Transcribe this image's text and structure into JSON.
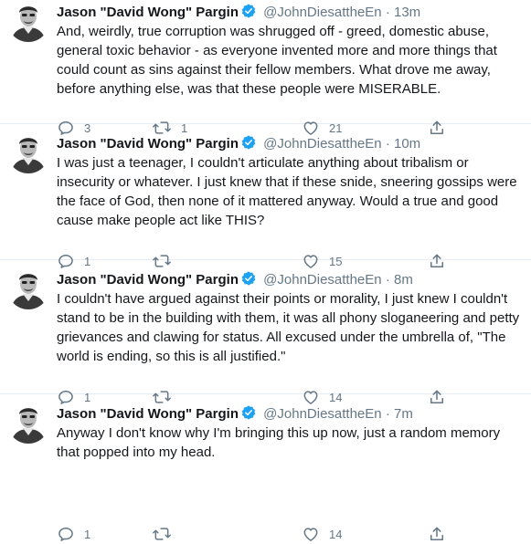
{
  "colors": {
    "text": "#14171a",
    "secondary": "#657786",
    "verified": "#1da1f2",
    "divider": "#e6ecf0"
  },
  "tweets": [
    {
      "author": "Jason \"David Wong\" Pargin",
      "handle": "@JohnDiesattheEn",
      "time": "13m",
      "text": "And, weirdly, true corruption was shrugged off - greed, domestic abuse, general toxic behavior - as everyone invented more and more things that could count as sins against their fellow members. What drove me away, before anything else, was that these people were MISERABLE.",
      "replies": "3",
      "retweets": "1",
      "likes": "21"
    },
    {
      "author": "Jason \"David Wong\" Pargin",
      "handle": "@JohnDiesattheEn",
      "time": "10m",
      "text": "I was just a teenager, I couldn't articulate anything about tribalism or insecurity or whatever. I just knew that if these snide, sneering gossips were the face of God, then none of it mattered anyway. Would a true and good cause make people act like THIS?",
      "replies": "1",
      "retweets": "",
      "likes": "15"
    },
    {
      "author": "Jason \"David Wong\" Pargin",
      "handle": "@JohnDiesattheEn",
      "time": "8m",
      "text": "I couldn't have argued against their points or morality, I just knew I couldn't stand to be in the building with them, it was all phony sloganeering and petty grievances and clawing for status. All excused under the umbrella of, \"The world is ending, so this is all justified.\"",
      "replies": "1",
      "retweets": "",
      "likes": "14"
    },
    {
      "author": "Jason \"David Wong\" Pargin",
      "handle": "@JohnDiesattheEn",
      "time": "7m",
      "text": "Anyway I don't know why I'm bringing this up now, just a random memory that popped into my head.",
      "replies": "1",
      "retweets": "",
      "likes": "14"
    }
  ]
}
